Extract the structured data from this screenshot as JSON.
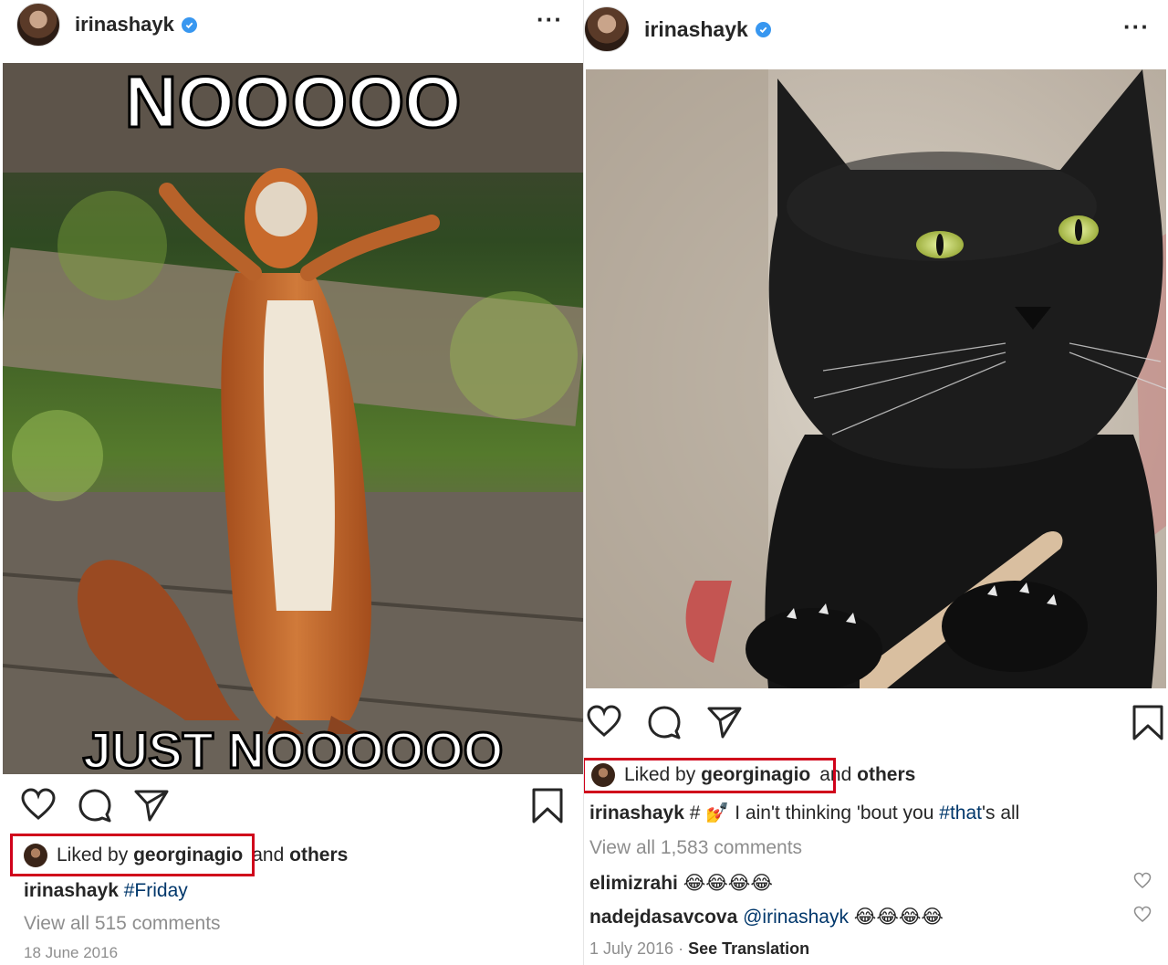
{
  "left_post": {
    "username": "irinashayk",
    "meme_top": "NOOOOO",
    "meme_bottom": "JUST NOOOOOO",
    "liked_prefix": "Liked by ",
    "liked_user": "georginagio",
    "liked_suffix": " and ",
    "liked_others": "others",
    "caption_user": "irinashayk",
    "caption_text": "#Friday",
    "view_comments": "View all 515 comments",
    "date": "18 June 2016"
  },
  "right_post": {
    "username": "irinashayk",
    "liked_prefix": "Liked by ",
    "liked_user": "georginagio",
    "liked_suffix": " and ",
    "liked_others": "others",
    "caption_user": "irinashayk",
    "caption_hash": " # ",
    "caption_emoji": "💅",
    "caption_text": " I ain't thinking 'bout you ",
    "caption_tag": "#that",
    "caption_end": "'s all",
    "view_comments": "View all 1,583 comments",
    "comments": [
      {
        "user": "elimizrahi",
        "text": " 😂😂😂😂"
      },
      {
        "user": "nadejdasavcova",
        "mention": " @irinashayk",
        "text": " 😂😂😂😂"
      }
    ],
    "date": "1 July 2016",
    "date_sep": " · ",
    "see_translation": "See Translation"
  },
  "colors": {
    "highlight_box": "#d0021b",
    "verified": "#3897f0",
    "hashtag": "#00376b",
    "muted": "#8e8e8e"
  },
  "icons": [
    "heart-icon",
    "comment-icon",
    "share-icon",
    "bookmark-icon",
    "more-icon",
    "verified-icon"
  ]
}
